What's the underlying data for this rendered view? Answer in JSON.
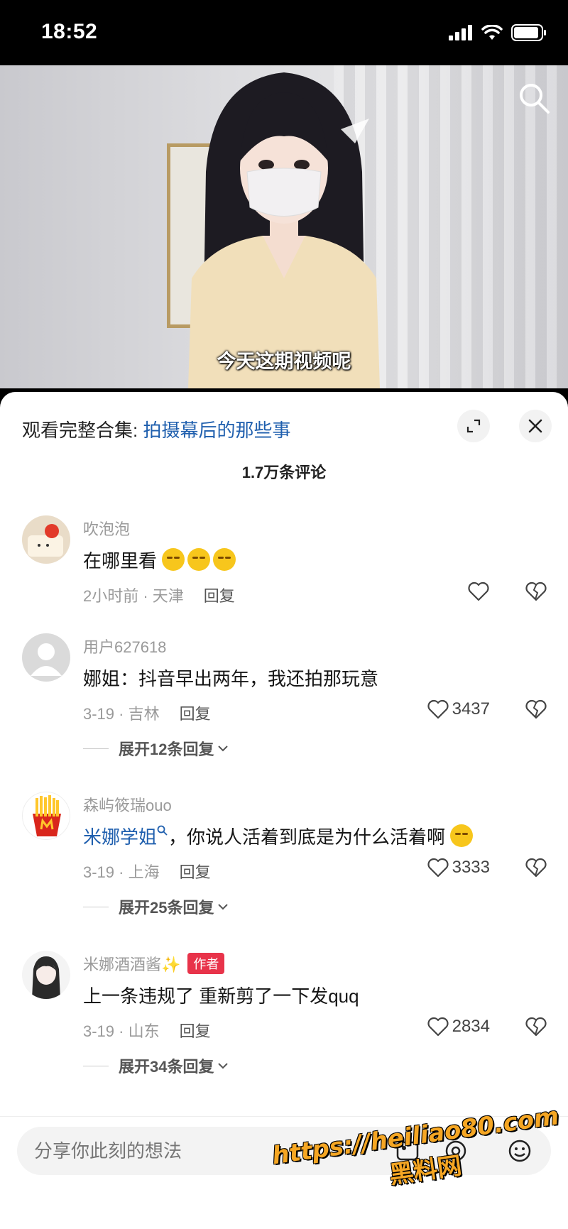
{
  "status_bar": {
    "time": "18:52"
  },
  "video": {
    "caption": "今天这期视频呢"
  },
  "sheet": {
    "collection_prefix": "观看完整合集: ",
    "collection_link": "拍摄幕后的那些事",
    "comment_count": "1.7万条评论"
  },
  "comments": [
    {
      "user": "吹泡泡",
      "text": "在哪里看",
      "time_location": "2小时前 · 天津",
      "reply": "回复",
      "likes": ""
    },
    {
      "user": "用户627618",
      "text": "娜姐：抖音早出两年，我还拍那玩意",
      "time_location": "3-19 · 吉林",
      "reply": "回复",
      "likes": "3437",
      "expand": "展开12条回复"
    },
    {
      "user": "森屿筱瑞ouo",
      "mention": "米娜学姐",
      "text": "，你说人活着到底是为什么活着啊",
      "time_location": "3-19 · 上海",
      "reply": "回复",
      "likes": "3333",
      "expand": "展开25条回复"
    },
    {
      "user": "米娜酒酒酱✨",
      "badge": "作者",
      "text": "上一条违规了 重新剪了一下发quq",
      "time_location": "3-19 · 山东",
      "reply": "回复",
      "likes": "2834",
      "expand": "展开34条回复"
    }
  ],
  "input": {
    "placeholder": "分享你此刻的想法"
  },
  "watermark": {
    "url": "https://heiliao80.com",
    "name": "黑料网"
  }
}
